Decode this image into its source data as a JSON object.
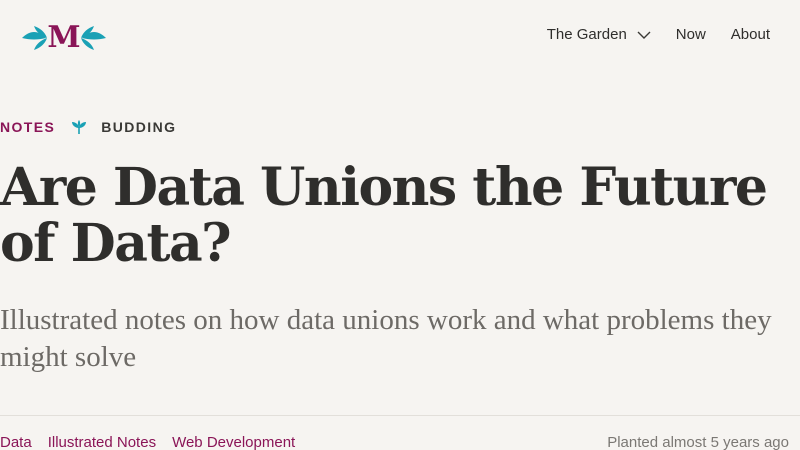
{
  "header": {
    "logo_letter": "M",
    "nav": [
      {
        "label": "The Garden",
        "has_dropdown": true
      },
      {
        "label": "Now"
      },
      {
        "label": "About"
      }
    ]
  },
  "post": {
    "type": "NOTES",
    "stage": "BUDDING",
    "title": "Are Data Unions the Future of Data?",
    "subtitle": "Illustrated notes on how data unions work and what problems they might solve",
    "tags": [
      "Data",
      "Illustrated Notes",
      "Web Development"
    ],
    "planted": "Planted almost 5 years ago"
  },
  "colors": {
    "background": "#f6f4f1",
    "accent": "#8a1557",
    "teal": "#1aa1b5",
    "text": "#2f2e2c"
  },
  "icons": {
    "logo_leaves": "leaf-icon",
    "nav_dropdown": "chevron-down-icon",
    "stage": "sprout-icon"
  }
}
